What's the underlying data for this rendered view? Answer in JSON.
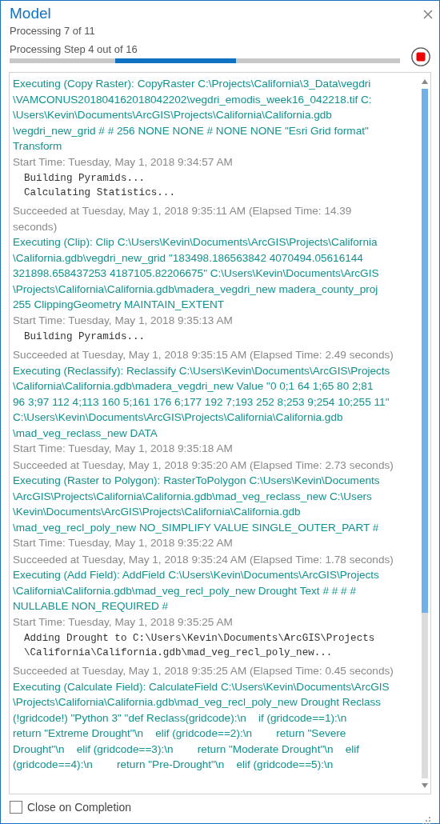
{
  "window": {
    "title": "Model"
  },
  "status": "Processing 7 of 11",
  "progress": {
    "label": "Processing Step 4 out of 16",
    "kind": "indeterminate"
  },
  "log": [
    {
      "kind": "executing",
      "lines": [
        "Executing (Copy Raster): CopyRaster C:\\Projects\\California\\3_Data\\vegdri",
        "\\VAMCONUS201804162018042202\\vegdri_emodis_week16_042218.tif C:",
        "\\Users\\Kevin\\Documents\\ArcGIS\\Projects\\California\\California.gdb",
        "\\vegdri_new_grid # # 256 NONE NONE # NONE NONE \"Esri Grid format\"",
        "Transform"
      ]
    },
    {
      "kind": "time",
      "lines": [
        "Start Time: Tuesday, May 1, 2018 9:34:57 AM"
      ]
    },
    {
      "kind": "message",
      "lines": [
        "Building Pyramids...",
        "Calculating Statistics..."
      ]
    },
    {
      "kind": "succeeded",
      "lines": [
        "Succeeded at Tuesday, May 1, 2018 9:35:11 AM (Elapsed Time: 14.39",
        "seconds)"
      ]
    },
    {
      "kind": "executing",
      "lines": [
        "Executing (Clip): Clip C:\\Users\\Kevin\\Documents\\ArcGIS\\Projects\\California",
        "\\California.gdb\\vegdri_new_grid \"183498.186563842 4070494.05616144",
        "321898.658437253 4187105.82206675\" C:\\Users\\Kevin\\Documents\\ArcGIS",
        "\\Projects\\California\\California.gdb\\madera_vegdri_new madera_county_proj",
        "255 ClippingGeometry MAINTAIN_EXTENT"
      ]
    },
    {
      "kind": "time",
      "lines": [
        "Start Time: Tuesday, May 1, 2018 9:35:13 AM"
      ]
    },
    {
      "kind": "message",
      "lines": [
        "Building Pyramids..."
      ]
    },
    {
      "kind": "succeeded",
      "lines": [
        "Succeeded at Tuesday, May 1, 2018 9:35:15 AM (Elapsed Time: 2.49 seconds)"
      ]
    },
    {
      "kind": "executing",
      "lines": [
        "Executing (Reclassify): Reclassify C:\\Users\\Kevin\\Documents\\ArcGIS\\Projects",
        "\\California\\California.gdb\\madera_vegdri_new Value \"0 0;1 64 1;65 80 2;81",
        "96 3;97 112 4;113 160 5;161 176 6;177 192 7;193 252 8;253 9;254 10;255 11\"",
        "C:\\Users\\Kevin\\Documents\\ArcGIS\\Projects\\California\\California.gdb",
        "\\mad_veg_reclass_new DATA"
      ]
    },
    {
      "kind": "time",
      "lines": [
        "Start Time: Tuesday, May 1, 2018 9:35:18 AM"
      ]
    },
    {
      "kind": "succeeded",
      "lines": [
        "Succeeded at Tuesday, May 1, 2018 9:35:20 AM (Elapsed Time: 2.73 seconds)"
      ]
    },
    {
      "kind": "executing",
      "lines": [
        "Executing (Raster to Polygon): RasterToPolygon C:\\Users\\Kevin\\Documents",
        "\\ArcGIS\\Projects\\California\\California.gdb\\mad_veg_reclass_new C:\\Users",
        "\\Kevin\\Documents\\ArcGIS\\Projects\\California\\California.gdb",
        "\\mad_veg_recl_poly_new NO_SIMPLIFY VALUE SINGLE_OUTER_PART #"
      ]
    },
    {
      "kind": "time",
      "lines": [
        "Start Time: Tuesday, May 1, 2018 9:35:22 AM"
      ]
    },
    {
      "kind": "succeeded",
      "lines": [
        "Succeeded at Tuesday, May 1, 2018 9:35:24 AM (Elapsed Time: 1.78 seconds)"
      ]
    },
    {
      "kind": "executing",
      "lines": [
        "Executing (Add Field): AddField C:\\Users\\Kevin\\Documents\\ArcGIS\\Projects",
        "\\California\\California.gdb\\mad_veg_recl_poly_new Drought Text # # # #",
        "NULLABLE NON_REQUIRED #"
      ]
    },
    {
      "kind": "time",
      "lines": [
        "Start Time: Tuesday, May 1, 2018 9:35:25 AM"
      ]
    },
    {
      "kind": "message",
      "lines": [
        "Adding Drought to C:\\Users\\Kevin\\Documents\\ArcGIS\\Projects",
        "\\California\\California.gdb\\mad_veg_recl_poly_new..."
      ]
    },
    {
      "kind": "succeeded",
      "lines": [
        "Succeeded at Tuesday, May 1, 2018 9:35:25 AM (Elapsed Time: 0.45 seconds)"
      ]
    },
    {
      "kind": "executing",
      "lines": [
        "Executing (Calculate Field): CalculateField C:\\Users\\Kevin\\Documents\\ArcGIS",
        "\\Projects\\California\\California.gdb\\mad_veg_recl_poly_new Drought Reclass",
        "(!gridcode!) \"Python 3\" \"def Reclass(gridcode):\\n    if (gridcode==1):\\n",
        "return \"Extreme Drought\"\\n    elif (gridcode==2):\\n        return \"Severe",
        "Drought\"\\n    elif (gridcode==3):\\n        return \"Moderate Drought\"\\n    elif",
        "(gridcode==4):\\n        return \"Pre-Drought\"\\n    elif (gridcode==5):\\n"
      ]
    }
  ],
  "close_on_completion": {
    "label": "Close on Completion",
    "checked": false
  }
}
